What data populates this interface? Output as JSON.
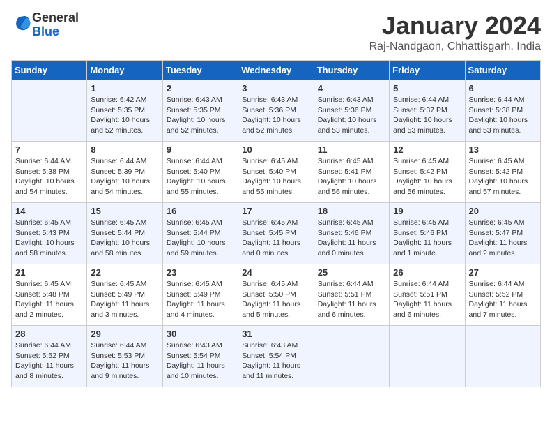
{
  "logo": {
    "general": "General",
    "blue": "Blue"
  },
  "title": "January 2024",
  "subtitle": "Raj-Nandgaon, Chhattisgarh, India",
  "headers": [
    "Sunday",
    "Monday",
    "Tuesday",
    "Wednesday",
    "Thursday",
    "Friday",
    "Saturday"
  ],
  "weeks": [
    [
      {
        "num": "",
        "info": ""
      },
      {
        "num": "1",
        "info": "Sunrise: 6:42 AM\nSunset: 5:35 PM\nDaylight: 10 hours\nand 52 minutes."
      },
      {
        "num": "2",
        "info": "Sunrise: 6:43 AM\nSunset: 5:35 PM\nDaylight: 10 hours\nand 52 minutes."
      },
      {
        "num": "3",
        "info": "Sunrise: 6:43 AM\nSunset: 5:36 PM\nDaylight: 10 hours\nand 52 minutes."
      },
      {
        "num": "4",
        "info": "Sunrise: 6:43 AM\nSunset: 5:36 PM\nDaylight: 10 hours\nand 53 minutes."
      },
      {
        "num": "5",
        "info": "Sunrise: 6:44 AM\nSunset: 5:37 PM\nDaylight: 10 hours\nand 53 minutes."
      },
      {
        "num": "6",
        "info": "Sunrise: 6:44 AM\nSunset: 5:38 PM\nDaylight: 10 hours\nand 53 minutes."
      }
    ],
    [
      {
        "num": "7",
        "info": "Sunrise: 6:44 AM\nSunset: 5:38 PM\nDaylight: 10 hours\nand 54 minutes."
      },
      {
        "num": "8",
        "info": "Sunrise: 6:44 AM\nSunset: 5:39 PM\nDaylight: 10 hours\nand 54 minutes."
      },
      {
        "num": "9",
        "info": "Sunrise: 6:44 AM\nSunset: 5:40 PM\nDaylight: 10 hours\nand 55 minutes."
      },
      {
        "num": "10",
        "info": "Sunrise: 6:45 AM\nSunset: 5:40 PM\nDaylight: 10 hours\nand 55 minutes."
      },
      {
        "num": "11",
        "info": "Sunrise: 6:45 AM\nSunset: 5:41 PM\nDaylight: 10 hours\nand 56 minutes."
      },
      {
        "num": "12",
        "info": "Sunrise: 6:45 AM\nSunset: 5:42 PM\nDaylight: 10 hours\nand 56 minutes."
      },
      {
        "num": "13",
        "info": "Sunrise: 6:45 AM\nSunset: 5:42 PM\nDaylight: 10 hours\nand 57 minutes."
      }
    ],
    [
      {
        "num": "14",
        "info": "Sunrise: 6:45 AM\nSunset: 5:43 PM\nDaylight: 10 hours\nand 58 minutes."
      },
      {
        "num": "15",
        "info": "Sunrise: 6:45 AM\nSunset: 5:44 PM\nDaylight: 10 hours\nand 58 minutes."
      },
      {
        "num": "16",
        "info": "Sunrise: 6:45 AM\nSunset: 5:44 PM\nDaylight: 10 hours\nand 59 minutes."
      },
      {
        "num": "17",
        "info": "Sunrise: 6:45 AM\nSunset: 5:45 PM\nDaylight: 11 hours\nand 0 minutes."
      },
      {
        "num": "18",
        "info": "Sunrise: 6:45 AM\nSunset: 5:46 PM\nDaylight: 11 hours\nand 0 minutes."
      },
      {
        "num": "19",
        "info": "Sunrise: 6:45 AM\nSunset: 5:46 PM\nDaylight: 11 hours\nand 1 minute."
      },
      {
        "num": "20",
        "info": "Sunrise: 6:45 AM\nSunset: 5:47 PM\nDaylight: 11 hours\nand 2 minutes."
      }
    ],
    [
      {
        "num": "21",
        "info": "Sunrise: 6:45 AM\nSunset: 5:48 PM\nDaylight: 11 hours\nand 2 minutes."
      },
      {
        "num": "22",
        "info": "Sunrise: 6:45 AM\nSunset: 5:49 PM\nDaylight: 11 hours\nand 3 minutes."
      },
      {
        "num": "23",
        "info": "Sunrise: 6:45 AM\nSunset: 5:49 PM\nDaylight: 11 hours\nand 4 minutes."
      },
      {
        "num": "24",
        "info": "Sunrise: 6:45 AM\nSunset: 5:50 PM\nDaylight: 11 hours\nand 5 minutes."
      },
      {
        "num": "25",
        "info": "Sunrise: 6:44 AM\nSunset: 5:51 PM\nDaylight: 11 hours\nand 6 minutes."
      },
      {
        "num": "26",
        "info": "Sunrise: 6:44 AM\nSunset: 5:51 PM\nDaylight: 11 hours\nand 6 minutes."
      },
      {
        "num": "27",
        "info": "Sunrise: 6:44 AM\nSunset: 5:52 PM\nDaylight: 11 hours\nand 7 minutes."
      }
    ],
    [
      {
        "num": "28",
        "info": "Sunrise: 6:44 AM\nSunset: 5:52 PM\nDaylight: 11 hours\nand 8 minutes."
      },
      {
        "num": "29",
        "info": "Sunrise: 6:44 AM\nSunset: 5:53 PM\nDaylight: 11 hours\nand 9 minutes."
      },
      {
        "num": "30",
        "info": "Sunrise: 6:43 AM\nSunset: 5:54 PM\nDaylight: 11 hours\nand 10 minutes."
      },
      {
        "num": "31",
        "info": "Sunrise: 6:43 AM\nSunset: 5:54 PM\nDaylight: 11 hours\nand 11 minutes."
      },
      {
        "num": "",
        "info": ""
      },
      {
        "num": "",
        "info": ""
      },
      {
        "num": "",
        "info": ""
      }
    ]
  ]
}
